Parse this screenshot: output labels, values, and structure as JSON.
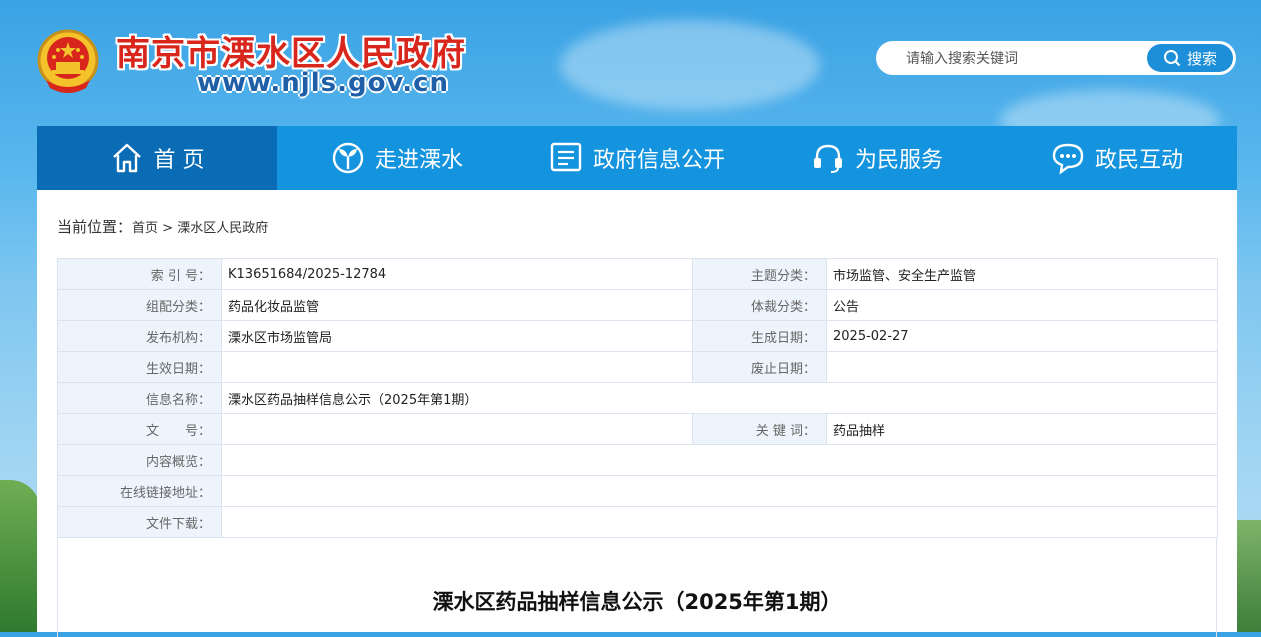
{
  "header": {
    "site_title": "南京市溧水区人民政府",
    "site_url": "www.njls.gov.cn",
    "search": {
      "placeholder": "请输入搜索关键词",
      "button_label": "搜索"
    }
  },
  "nav": {
    "items": [
      {
        "label": "首 页",
        "icon": "home-icon",
        "active": true
      },
      {
        "label": "走进溧水",
        "icon": "sprout-icon"
      },
      {
        "label": "政府信息公开",
        "icon": "document-icon"
      },
      {
        "label": "为民服务",
        "icon": "headset-icon"
      },
      {
        "label": "政民互动",
        "icon": "chat-icon"
      }
    ]
  },
  "breadcrumb": {
    "lead": "当前位置：",
    "items": [
      "首页",
      "溧水区人民政府"
    ],
    "separator": ">"
  },
  "meta": {
    "index_no_label": "索 引 号：",
    "index_no": "K13651684/2025-12784",
    "theme_label": "主题分类：",
    "theme": "市场监管、安全生产监管",
    "org_class_label": "组配分类：",
    "org_class": "药品化妆品监管",
    "genre_label": "体裁分类：",
    "genre": "公告",
    "publisher_label": "发布机构：",
    "publisher": "溧水区市场监管局",
    "created_label": "生成日期：",
    "created": "2025-02-27",
    "effective_label": "生效日期：",
    "effective": "",
    "abolished_label": "废止日期：",
    "abolished": "",
    "name_label": "信息名称：",
    "name": "溧水区药品抽样信息公示（2025年第1期）",
    "doc_no_label": "文　　号：",
    "doc_no": "",
    "keywords_label": "关 键 词：",
    "keywords": "药品抽样",
    "summary_label": "内容概览：",
    "summary": "",
    "link_label": "在线链接地址：",
    "link": "",
    "download_label": "文件下载：",
    "download": ""
  },
  "article": {
    "title": "溧水区药品抽样信息公示（2025年第1期）"
  },
  "colors": {
    "nav_bg": "#1493df",
    "nav_active": "#0a6cb5",
    "title_red": "#d8261c",
    "label_bg": "#edf4fb"
  }
}
